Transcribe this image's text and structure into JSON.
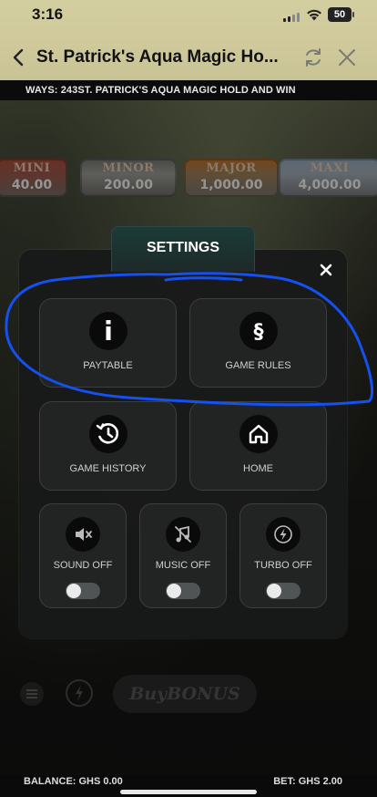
{
  "status_bar": {
    "time": "3:16",
    "battery": "50"
  },
  "browser": {
    "title": "St. Patrick's Aqua Magic Ho...",
    "icons": [
      "back-chevron-icon",
      "reload-icon",
      "close-icon"
    ]
  },
  "game": {
    "ways_text": "WAYS: 243ST. PATRICK'S AQUA MAGIC HOLD AND WIN",
    "jackpots": [
      {
        "name": "MINI",
        "value": "40.00"
      },
      {
        "name": "MINOR",
        "value": "200.00"
      },
      {
        "name": "MAJOR",
        "value": "1,000.00"
      },
      {
        "name": "MAXI",
        "value": "4,000.00"
      }
    ],
    "buy_bonus": "BuyBONUS",
    "balance": "BALANCE: GHS 0.00",
    "bet": "BET: GHS 2.00"
  },
  "settings": {
    "title": "SETTINGS",
    "paytable": {
      "label": "PAYTABLE",
      "icon": "i"
    },
    "game_rules": {
      "label": "GAME RULES",
      "icon": "§"
    },
    "game_history": {
      "label": "GAME HISTORY",
      "icon": "history-icon"
    },
    "home": {
      "label": "HOME",
      "icon": "home-icon"
    },
    "sound": {
      "label": "SOUND OFF",
      "on": false
    },
    "music": {
      "label": "MUSIC OFF",
      "on": false
    },
    "turbo": {
      "label": "TURBO OFF",
      "on": false
    }
  },
  "colors": {
    "annotation": "#1550f0",
    "modal_bg": "#181919",
    "tab_bg": "#1c3b37"
  }
}
